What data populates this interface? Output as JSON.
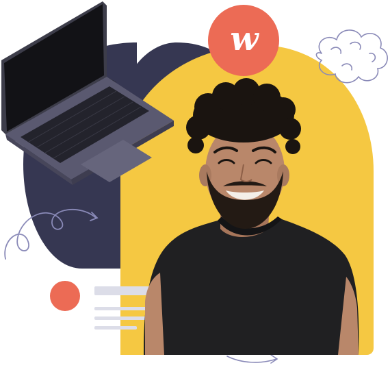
{
  "brand": {
    "logo_text": "w"
  },
  "colors": {
    "navy": "#363752",
    "yellow": "#f5c842",
    "coral": "#ec6b55",
    "doodle": "#8a8ab8",
    "placeholder_bar": "#dcdde8",
    "laptop_body": "#5a5970",
    "laptop_dark": "#2c2c36",
    "screen": "#121216",
    "shirt": "#202022",
    "skin": "#b9876a",
    "hair": "#1a1410"
  },
  "icons": {
    "laptop": "laptop-illustration",
    "cloud": "cloud-doodle",
    "swirl": "swirl-doodle",
    "arrow": "curved-arrow-doodle"
  }
}
